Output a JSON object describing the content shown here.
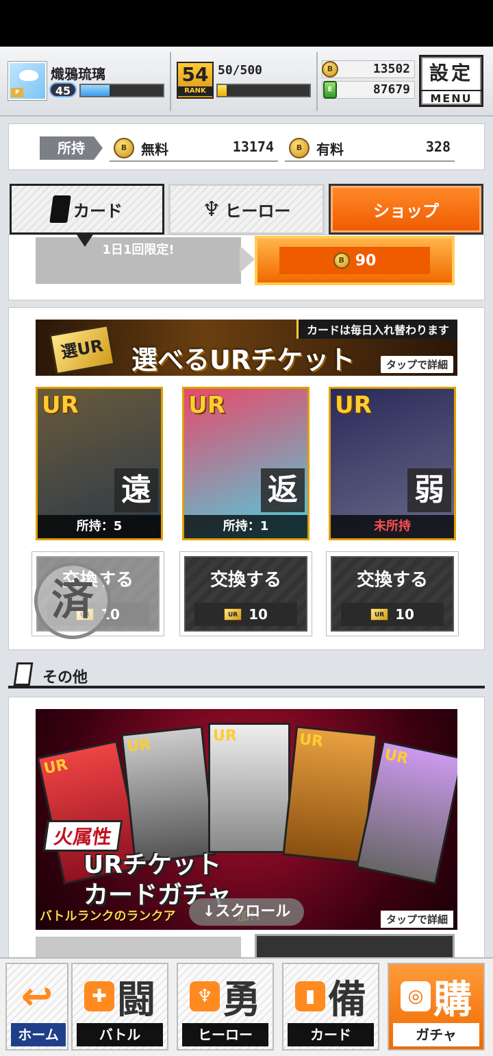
{
  "header": {
    "player_name": "熾鴉琉璃",
    "level": "45",
    "xp_fraction": 0.35,
    "rank": "54",
    "rank_label": "RANK",
    "stamina": "50/500",
    "stamina_fraction": 0.1,
    "coin_icon": "B",
    "gem_icon": "E",
    "coins": "13502",
    "gems": "87679",
    "menu_kanji": "設定",
    "menu_label": "MENU"
  },
  "holdings": {
    "label": "所持",
    "free_label": "無料",
    "free_value": "13174",
    "paid_label": "有料",
    "paid_value": "328"
  },
  "tabs": {
    "card": "カード",
    "hero": "ヒーロー",
    "shop": "ショップ"
  },
  "daily": {
    "limit_text": "1日1回限定!",
    "price": "90"
  },
  "ur_ticket": {
    "top_note": "カードは毎日入れ替わります",
    "title": "選べるURチケット",
    "ticket_art": "選UR",
    "tap_detail": "タップで詳細",
    "cards": [
      {
        "rarity": "UR",
        "kanji": "遠",
        "owned": "所持：5",
        "color_a": "#6a5a3a",
        "color_b": "#2a3a4a"
      },
      {
        "rarity": "UR",
        "kanji": "返",
        "owned": "所持：1",
        "color_a": "#e84a6a",
        "color_b": "#4ad0e0"
      },
      {
        "rarity": "UR",
        "kanji": "弱",
        "owned": "未所持",
        "color_a": "#2a2a5a",
        "color_b": "#6a6a8a"
      }
    ],
    "exchange_label": "交換する",
    "exchange_cost": "10",
    "done_stamp": "済"
  },
  "other": {
    "heading": "その他",
    "gacha": {
      "attribute": "火属性",
      "title_line1": "URチケット",
      "title_line2": "カードガチャ",
      "caption": "バトルランクのランクア　　　　　加!!",
      "tap_detail": "タップで詳細",
      "card_kanji": [
        "UR",
        "UR",
        "UR",
        "UR",
        "UR"
      ]
    },
    "scroll_hint": "↓スクロール"
  },
  "nav": {
    "home": "ホーム",
    "battle": "バトル",
    "hero": "ヒーロー",
    "card": "カード",
    "gacha": "ガチャ",
    "battle_kanji": "闘",
    "hero_kanji": "勇",
    "card_kanji": "備",
    "gacha_kanji": "購"
  },
  "colors": {
    "accent_orange": "#f06a00",
    "unowned_red": "#ff5050",
    "home_blue": "#1f3f8a"
  }
}
